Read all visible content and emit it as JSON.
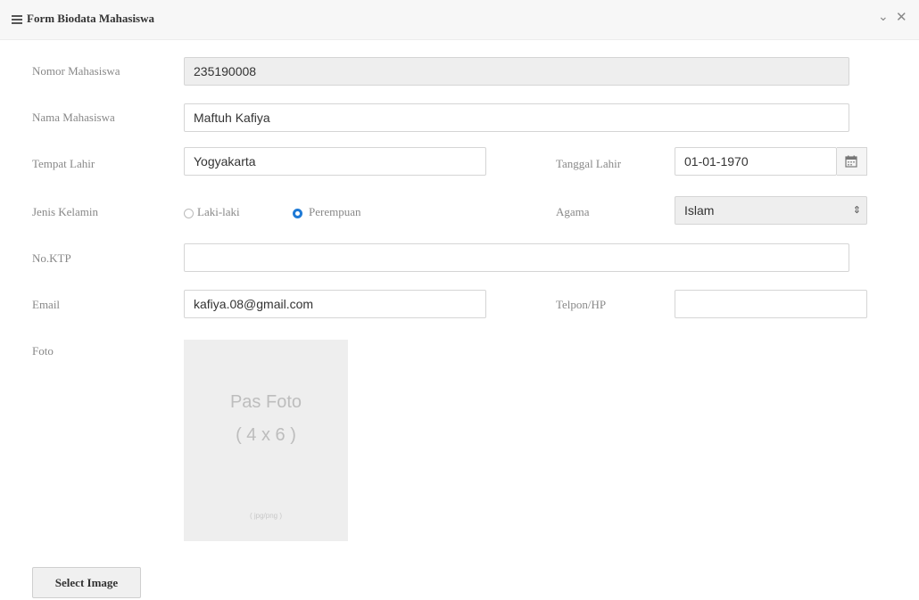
{
  "window": {
    "title": "Form Biodata Mahasiswa",
    "collapse_glyph": "⌄",
    "close_glyph": "✕"
  },
  "form": {
    "nomor": {
      "label": "Nomor Mahasiswa",
      "value": "235190008"
    },
    "nama": {
      "label": "Nama Mahasiswa",
      "value": "Maftuh Kafiya"
    },
    "tempat_lahir": {
      "label": "Tempat Lahir",
      "value": "Yogyakarta"
    },
    "tanggal_lahir": {
      "label": "Tanggal Lahir",
      "value": "01-01-1970"
    },
    "jenis_kelamin": {
      "label": "Jenis Kelamin",
      "options": [
        {
          "label": "Laki-laki",
          "selected": false
        },
        {
          "label": "Perempuan",
          "selected": true
        }
      ]
    },
    "agama": {
      "label": "Agama",
      "value": "Islam",
      "arrow": "⇕"
    },
    "no_ktp": {
      "label": "No.KTP",
      "value": ""
    },
    "email": {
      "label": "Email",
      "value": "kafiya.08@gmail.com"
    },
    "telpon": {
      "label": "Telpon/HP",
      "value": ""
    },
    "foto": {
      "label": "Foto",
      "placeholder_line1": "Pas Foto",
      "placeholder_line2": "( 4 x 6 )",
      "placeholder_foot": "( jpg/png )"
    },
    "select_image_label": "Select Image"
  },
  "icons": {
    "menu": "hamburger-menu-icon",
    "calendar": "calendar-icon",
    "select_arrow": "select-arrow-icon",
    "collapse": "chevron-down-icon",
    "close": "close-icon"
  },
  "colors": {
    "radio_selected": "#1f7ad6",
    "readonly_bg": "#eeeeee",
    "titlebar_bg": "#f7f7f7"
  }
}
